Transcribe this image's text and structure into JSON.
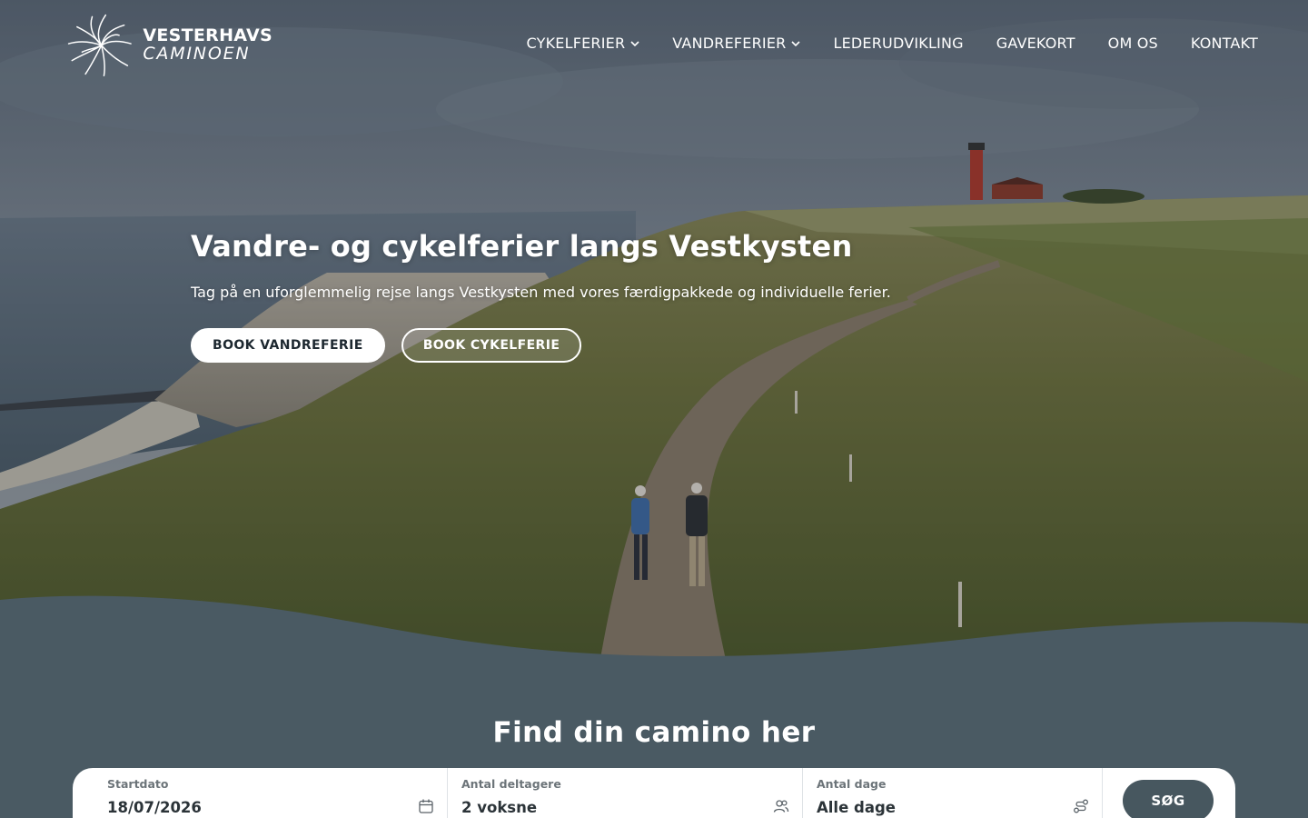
{
  "brand": {
    "line1": "VESTERHAVS",
    "line2": "CAMINOEN"
  },
  "nav": {
    "items": [
      {
        "label": "CYKELFERIER"
      },
      {
        "label": "VANDREFERIER"
      },
      {
        "label": "LEDERUDVIKLING"
      },
      {
        "label": "GAVEKORT"
      },
      {
        "label": "OM OS"
      },
      {
        "label": "KONTAKT"
      }
    ]
  },
  "hero": {
    "title": "Vandre- og cykelferier langs Vestkysten",
    "subtitle": "Tag på en uforglemmelig rejse langs Vestkysten med vores færdigpakkede og individuelle ferier.",
    "primary_button": "BOOK VANDREFERIE",
    "secondary_button": "BOOK CYKELFERIE"
  },
  "search": {
    "title": "Find din camino her",
    "fields": [
      {
        "label": "Startdato",
        "value": "18/07/2026",
        "icon": "calendar-icon"
      },
      {
        "label": "Antal deltagere",
        "value": "2 voksne",
        "icon": "users-icon"
      },
      {
        "label": "Antal dage",
        "value": "Alle dage",
        "icon": "route-icon"
      }
    ],
    "button": "SØG"
  },
  "colors": {
    "section_bg": "#4a5a63",
    "button_dark": "#47575f",
    "text_dark": "#2b3338"
  }
}
